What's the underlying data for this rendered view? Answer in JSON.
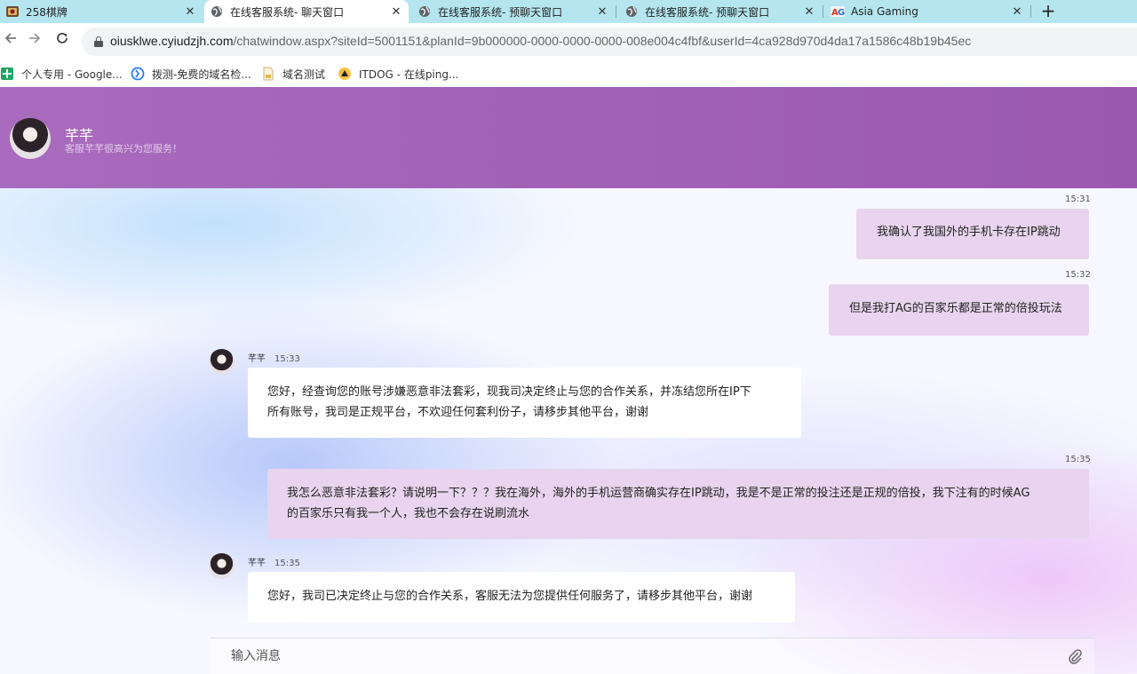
{
  "tabs": [
    {
      "title": "258棋牌",
      "icon": "card-game-icon",
      "active": false
    },
    {
      "title": "在线客服系统- 聊天窗口",
      "icon": "globe-icon",
      "active": true
    },
    {
      "title": "在线客服系统- 预聊天窗口",
      "icon": "globe-icon",
      "active": false
    },
    {
      "title": "在线客服系统- 预聊天窗口",
      "icon": "globe-icon",
      "active": false
    },
    {
      "title": "Asia Gaming",
      "icon": "ag-logo-icon",
      "active": false
    }
  ],
  "tab_close": "✕",
  "new_tab": "+",
  "address": {
    "host": "oiusklwe.cyiudzjh.com",
    "path": "/chatwindow.aspx?siteId=5001151&planId=9b000000-0000-0000-0000-008e004c4fbf&userId=4ca928d970d4da17a1586c48b19b45ec"
  },
  "bookmarks": [
    {
      "label": "个人专用 - Google...",
      "icon": "google-sheets-icon"
    },
    {
      "label": "拨测-免费的域名检...",
      "icon": "boce-icon"
    },
    {
      "label": "域名测试",
      "icon": "page-icon"
    },
    {
      "label": "ITDOG - 在线ping...",
      "icon": "itdog-icon"
    }
  ],
  "header": {
    "name": "芊芊",
    "subtitle": "客服芊芊很高兴为您服务！"
  },
  "messages": [
    {
      "dir": "out",
      "time": "15:31",
      "text": "我确认了我国外的手机卡存在IP跳动"
    },
    {
      "dir": "out",
      "time": "15:32",
      "text": "但是我打AG的百家乐都是正常的倍投玩法"
    },
    {
      "dir": "in",
      "sender": "芊芊",
      "time": "15:33",
      "lines": [
        "您好，经查询您的账号涉嫌恶意非法套彩，现我司决定终止与您的合作关系，并冻结您所在IP下",
        "所有账号，我司是正规平台，不欢迎任何套利份子，请移步其他平台，谢谢"
      ]
    },
    {
      "dir": "out",
      "time": "15:35",
      "lines": [
        "我怎么恶意非法套彩？请说明一下？？？我在海外，海外的手机运营商确实存在IP跳动，我是不是正常的投注还是正规的倍投，我下注有的时候AG",
        "的百家乐只有我一个人，我也不会存在说刷流水"
      ]
    },
    {
      "dir": "in",
      "sender": "芊芊",
      "time": "15:35",
      "text": "您好，我司已决定终止与您的合作关系，客服无法为您提供任何服务了，请移步其他平台，谢谢"
    }
  ],
  "input": {
    "placeholder": "输入消息"
  },
  "colors": {
    "header": "#a066b8",
    "out_bubble": "#e8d4ee",
    "in_bubble": "#ffffff",
    "tabstrip": "#b5e6ef"
  }
}
